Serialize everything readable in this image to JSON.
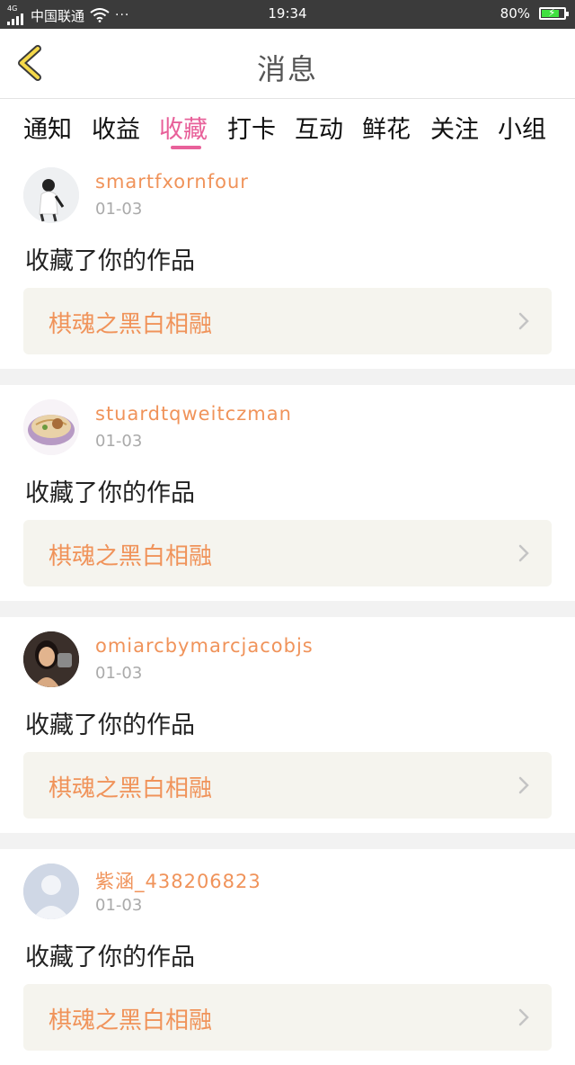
{
  "status_bar": {
    "network_type": "4G",
    "carrier": "中国联通",
    "dots": "···",
    "time": "19:34",
    "battery": "80%",
    "battery_level": 0.8
  },
  "header": {
    "title": "消息"
  },
  "tabs": [
    {
      "label": "通知"
    },
    {
      "label": "收益"
    },
    {
      "label": "收藏",
      "active": true
    },
    {
      "label": "打卡"
    },
    {
      "label": "互动"
    },
    {
      "label": "鲜花"
    },
    {
      "label": "关注"
    },
    {
      "label": "小组"
    }
  ],
  "colors": {
    "accent_pink": "#e8619a",
    "accent_orange": "#f0935a"
  },
  "messages": [
    {
      "username": "smartfxornfour",
      "date": "01-03",
      "action": "收藏了你的作品",
      "work_title": "棋魂之黑白相融"
    },
    {
      "username": "stuardtqweitczman",
      "date": "01-03",
      "action": "收藏了你的作品",
      "work_title": "棋魂之黑白相融"
    },
    {
      "username": "omiarcbymarcjacobjs",
      "date": "01-03",
      "action": "收藏了你的作品",
      "work_title": "棋魂之黑白相融"
    },
    {
      "username": "紫涵_438206823",
      "date": "01-03",
      "action": "收藏了你的作品",
      "work_title": "棋魂之黑白相融"
    }
  ]
}
